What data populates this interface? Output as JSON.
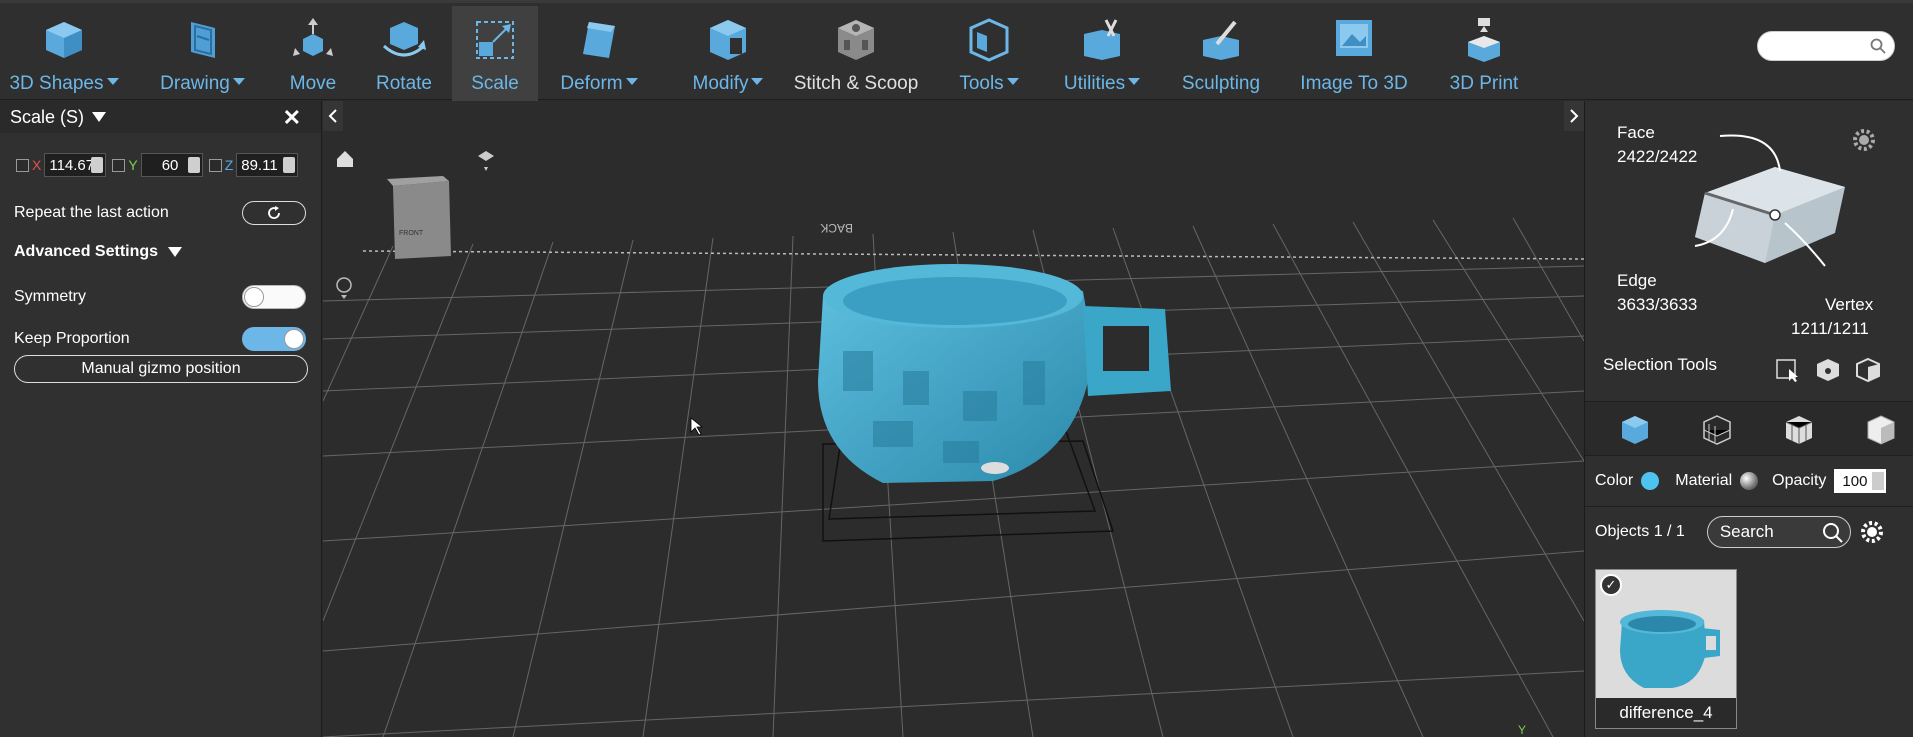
{
  "toolbar": {
    "tools": [
      {
        "label": "3D Shapes",
        "dropdown": true
      },
      {
        "label": "Drawing",
        "dropdown": true
      },
      {
        "label": "Move",
        "dropdown": false
      },
      {
        "label": "Rotate",
        "dropdown": false
      },
      {
        "label": "Scale",
        "dropdown": false,
        "active": true
      },
      {
        "label": "Deform",
        "dropdown": true
      },
      {
        "label": "Modify",
        "dropdown": true
      },
      {
        "label": "Stitch & Scoop",
        "dropdown": false
      },
      {
        "label": "Tools",
        "dropdown": true
      },
      {
        "label": "Utilities",
        "dropdown": true
      },
      {
        "label": "Sculpting",
        "dropdown": false
      },
      {
        "label": "Image To 3D",
        "dropdown": false
      },
      {
        "label": "3D Print",
        "dropdown": false
      }
    ],
    "search_value": ""
  },
  "left_panel": {
    "title": "Scale (S)",
    "x_label": "X",
    "x_value": "114.67",
    "y_label": "Y",
    "y_value": "60",
    "z_label": "Z",
    "z_value": "89.11",
    "repeat_label": "Repeat the last action",
    "advanced_label": "Advanced Settings",
    "symmetry_label": "Symmetry",
    "symmetry_on": false,
    "keep_proportion_label": "Keep Proportion",
    "keep_proportion_on": true,
    "manual_gizmo_label": "Manual gizmo position"
  },
  "viewport": {
    "view_cube_front": "FRONT",
    "view_cube_back": "BACK",
    "axis_y": "Y",
    "object_color": "#3aa6c8"
  },
  "right_panel": {
    "face_label": "Face",
    "face_count": "2422/2422",
    "edge_label": "Edge",
    "edge_count": "3633/3633",
    "vertex_label": "Vertex",
    "vertex_count": "1211/1211",
    "selection_tools_label": "Selection Tools",
    "color_label": "Color",
    "color_value": "#4fc3ef",
    "material_label": "Material",
    "opacity_label": "Opacity",
    "opacity_value": "100",
    "objects_label": "Objects 1 / 1",
    "search_placeholder": "Search",
    "object_name": "difference_4"
  }
}
